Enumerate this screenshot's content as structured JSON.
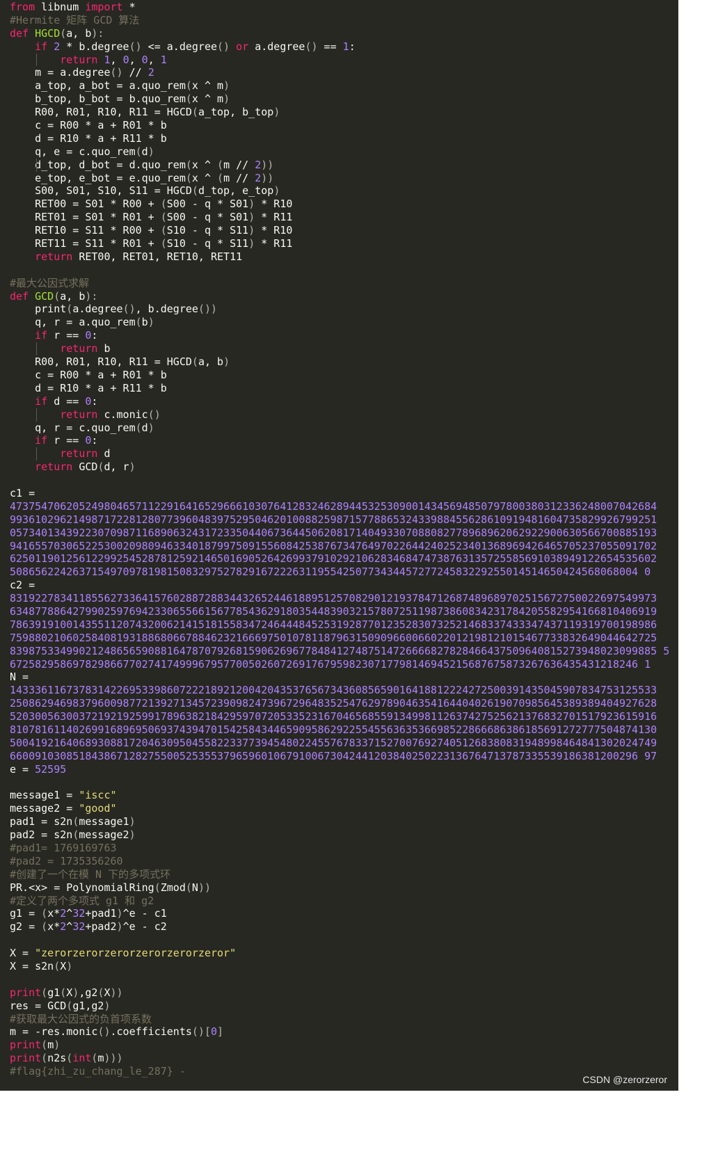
{
  "editor": {
    "theme": {
      "background": "#272822",
      "plain": "#f8f8f2",
      "keyword": "#f92672",
      "function": "#a6e22e",
      "number": "#ae81ff",
      "string": "#e6db74",
      "comment": "#75715e"
    },
    "lines": [
      [
        [
          "from",
          "kw"
        ],
        [
          " libnum ",
          "pl"
        ],
        [
          "import",
          "kw"
        ],
        [
          " *",
          "pl"
        ]
      ],
      [
        [
          "#Hermite 矩阵 GCD 算法",
          "cm"
        ]
      ],
      [
        [
          "def",
          "kw"
        ],
        [
          " ",
          "pl"
        ],
        [
          "HGCD",
          "fn"
        ],
        [
          "(",
          "pu"
        ],
        [
          "a, b",
          "pl"
        ],
        [
          "):",
          "pu"
        ]
      ],
      [
        [
          "    ",
          "pl"
        ],
        [
          "if",
          "kw"
        ],
        [
          " ",
          "pl"
        ],
        [
          "2",
          "num"
        ],
        [
          " * b.degree",
          "pl"
        ],
        [
          "()",
          "pu"
        ],
        [
          " <= a.degree",
          "pl"
        ],
        [
          "()",
          "pu"
        ],
        [
          " ",
          "pl"
        ],
        [
          "or",
          "kw"
        ],
        [
          " a.degree",
          "pl"
        ],
        [
          "()",
          "pu"
        ],
        [
          " == ",
          "pl"
        ],
        [
          "1",
          "num"
        ],
        [
          ":",
          "pl"
        ]
      ],
      [
        [
          "        ",
          "pl"
        ],
        [
          "return",
          "kw"
        ],
        [
          " ",
          "pl"
        ],
        [
          "1",
          "num"
        ],
        [
          ", ",
          "pl"
        ],
        [
          "0",
          "num"
        ],
        [
          ", ",
          "pl"
        ],
        [
          "0",
          "num"
        ],
        [
          ", ",
          "pl"
        ],
        [
          "1",
          "num"
        ]
      ],
      [
        [
          "    m = a.degree",
          "pl"
        ],
        [
          "()",
          "pu"
        ],
        [
          " // ",
          "pl"
        ],
        [
          "2",
          "num"
        ]
      ],
      [
        [
          "    a_top, a_bot = a.quo_rem",
          "pl"
        ],
        [
          "(",
          "pu"
        ],
        [
          "x ^ m",
          "pl"
        ],
        [
          ")",
          "pu"
        ]
      ],
      [
        [
          "    b_top, b_bot = b.quo_rem",
          "pl"
        ],
        [
          "(",
          "pu"
        ],
        [
          "x ^ m",
          "pl"
        ],
        [
          ")",
          "pu"
        ]
      ],
      [
        [
          "    R00, R01, R10, R11 = HGCD",
          "pl"
        ],
        [
          "(",
          "pu"
        ],
        [
          "a_top, b_top",
          "pl"
        ],
        [
          ")",
          "pu"
        ]
      ],
      [
        [
          "    c = R00 * a + R01 * b",
          "pl"
        ]
      ],
      [
        [
          "    d = R10 * a + R11 * b",
          "pl"
        ]
      ],
      [
        [
          "    q, e = c.quo_rem",
          "pl"
        ],
        [
          "(",
          "pu"
        ],
        [
          "d",
          "pl"
        ],
        [
          ")",
          "pu"
        ]
      ],
      [
        [
          "    d_top, d_bot = d.quo_rem",
          "pl"
        ],
        [
          "(",
          "pu"
        ],
        [
          "x ^ ",
          "pl"
        ],
        [
          "(",
          "pu"
        ],
        [
          "m // ",
          "pl"
        ],
        [
          "2",
          "num"
        ],
        [
          "))",
          "pu"
        ]
      ],
      [
        [
          "    e_top, e_bot = e.quo_rem",
          "pl"
        ],
        [
          "(",
          "pu"
        ],
        [
          "x ^ ",
          "pl"
        ],
        [
          "(",
          "pu"
        ],
        [
          "m // ",
          "pl"
        ],
        [
          "2",
          "num"
        ],
        [
          "))",
          "pu"
        ]
      ],
      [
        [
          "    S00, S01, S10, S11 = HGCD",
          "pl"
        ],
        [
          "(",
          "pu"
        ],
        [
          "d_top, e_top",
          "pl"
        ],
        [
          ")",
          "pu"
        ]
      ],
      [
        [
          "    RET00 = S01 * R00 + ",
          "pl"
        ],
        [
          "(",
          "pu"
        ],
        [
          "S00 - q * S01",
          "pl"
        ],
        [
          ")",
          "pu"
        ],
        [
          " * R10",
          "pl"
        ]
      ],
      [
        [
          "    RET01 = S01 * R01 + ",
          "pl"
        ],
        [
          "(",
          "pu"
        ],
        [
          "S00 - q * S01",
          "pl"
        ],
        [
          ")",
          "pu"
        ],
        [
          " * R11",
          "pl"
        ]
      ],
      [
        [
          "    RET10 = S11 * R00 + ",
          "pl"
        ],
        [
          "(",
          "pu"
        ],
        [
          "S10 - q * S11",
          "pl"
        ],
        [
          ")",
          "pu"
        ],
        [
          " * R10",
          "pl"
        ]
      ],
      [
        [
          "    RET11 = S11 * R01 + ",
          "pl"
        ],
        [
          "(",
          "pu"
        ],
        [
          "S10 - q * S11",
          "pl"
        ],
        [
          ")",
          "pu"
        ],
        [
          " * R11",
          "pl"
        ]
      ],
      [
        [
          "    ",
          "pl"
        ],
        [
          "return",
          "kw"
        ],
        [
          " RET00, RET01, RET10, RET11",
          "pl"
        ]
      ],
      [],
      [
        [
          "#最大公因式求解",
          "cm"
        ]
      ],
      [
        [
          "def",
          "kw"
        ],
        [
          " ",
          "pl"
        ],
        [
          "GCD",
          "fn"
        ],
        [
          "(",
          "pu"
        ],
        [
          "a, b",
          "pl"
        ],
        [
          "):",
          "pu"
        ]
      ],
      [
        [
          "    print",
          "pl"
        ],
        [
          "(",
          "pu"
        ],
        [
          "a.degree",
          "pl"
        ],
        [
          "()",
          "pu"
        ],
        [
          ", b.degree",
          "pl"
        ],
        [
          "())",
          "pu"
        ]
      ],
      [
        [
          "    q, r = a.quo_rem",
          "pl"
        ],
        [
          "(",
          "pu"
        ],
        [
          "b",
          "pl"
        ],
        [
          ")",
          "pu"
        ]
      ],
      [
        [
          "    ",
          "pl"
        ],
        [
          "if",
          "kw"
        ],
        [
          " r == ",
          "pl"
        ],
        [
          "0",
          "num"
        ],
        [
          ":",
          "pl"
        ]
      ],
      [
        [
          "        ",
          "pl"
        ],
        [
          "return",
          "kw"
        ],
        [
          " b",
          "pl"
        ]
      ],
      [
        [
          "    R00, R01, R10, R11 = HGCD",
          "pl"
        ],
        [
          "(",
          "pu"
        ],
        [
          "a, b",
          "pl"
        ],
        [
          ")",
          "pu"
        ]
      ],
      [
        [
          "    c = R00 * a + R01 * b",
          "pl"
        ]
      ],
      [
        [
          "    d = R10 * a + R11 * b",
          "pl"
        ]
      ],
      [
        [
          "    ",
          "pl"
        ],
        [
          "if",
          "kw"
        ],
        [
          " d == ",
          "pl"
        ],
        [
          "0",
          "num"
        ],
        [
          ":",
          "pl"
        ]
      ],
      [
        [
          "        ",
          "pl"
        ],
        [
          "return",
          "kw"
        ],
        [
          " c.monic",
          "pl"
        ],
        [
          "()",
          "pu"
        ]
      ],
      [
        [
          "    q, r = c.quo_rem",
          "pl"
        ],
        [
          "(",
          "pu"
        ],
        [
          "d",
          "pl"
        ],
        [
          ")",
          "pu"
        ]
      ],
      [
        [
          "    ",
          "pl"
        ],
        [
          "if",
          "kw"
        ],
        [
          " r == ",
          "pl"
        ],
        [
          "0",
          "num"
        ],
        [
          ":",
          "pl"
        ]
      ],
      [
        [
          "        ",
          "pl"
        ],
        [
          "return",
          "kw"
        ],
        [
          " d",
          "pl"
        ]
      ],
      [
        [
          "    ",
          "pl"
        ],
        [
          "return",
          "kw"
        ],
        [
          " GCD",
          "pl"
        ],
        [
          "(",
          "pu"
        ],
        [
          "d, r",
          "pl"
        ],
        [
          ")",
          "pu"
        ]
      ],
      [],
      [
        [
          "c1 =",
          "pl"
        ]
      ],
      [
        [
          "4737547062052498046571122916416529666103076412832462894453253090014345694850797800380312336248007042684",
          "big"
        ]
      ],
      [
        [
          "9936102962149871722812807739604839752950462010088259871577886532433988455628610919481604735829926799251",
          "big"
        ]
      ],
      [
        [
          "0573401343922307098711689063243172335044067364450620817140493307088082778968962062922900630566700885193",
          "big"
        ]
      ],
      [
        [
          "9416557030652253002098094633401879975091556084253876734764970226442402523401368969426465705237055091702",
          "big"
        ]
      ],
      [
        [
          "6250119012561229925452878125921465016905264269937910292106283468474738763135725585691038949122654535602",
          "big"
        ]
      ],
      [
        [
          "5086562242637154970978198150832975278291672226311955425077343445727724583229255014514650424568068004 0",
          "big"
        ]
      ],
      [
        [
          "c2 =",
          "pl"
        ]
      ],
      [
        [
          "8319227834118556273364157602887288344326524461889512570829012193784712687489689702515672750022697549973",
          "big"
        ]
      ],
      [
        [
          "6348778864279902597694233065566156778543629180354483903215780725119873860834231784205582954166810406919",
          "big"
        ]
      ],
      [
        [
          "7863919100143551120743200621415181558347246444845253192877012352830732521468337433347437119319700198986",
          "big"
        ]
      ],
      [
        [
          "7598802106025840819318868066788462321666975010781187963150909660066022012198121015467733832649044642725",
          "big"
        ]
      ],
      [
        [
          "8398753349902124865659088164787079268159062696778484127487514726666827828466437509640815273948023099885 5",
          "big"
        ]
      ],
      [
        [
          "6725829586978298667702741749996795770050260726917679598230717798146945215687675873267636435431218246 1",
          "big"
        ]
      ],
      [
        [
          "N =",
          "pl"
        ]
      ],
      [
        [
          "1433361167378314226953398607222189212004204353765673436085659016418812224272500391435045907834753125533",
          "big"
        ]
      ],
      [
        [
          "2508629469837960098772139271345723909824739672964835254762978904635416440402619070985645389389404927628",
          "big"
        ]
      ],
      [
        [
          "5203005630037219219259917896382184295970720533523167046568559134998112637427525621376832701517923615916",
          "big"
        ]
      ],
      [
        [
          "8107816114026991689695069374394701542584344659095862922554556363536698522866686386185691272777504874130",
          "big"
        ]
      ],
      [
        [
          "5004192164068930881720463095045582233773945480224557678337152700769274051268380831948998464841302024749",
          "big"
        ]
      ],
      [
        [
          "6600910308518438671282755005253553796596010679100673042441203840250223136764713787335539186381200296 97",
          "big"
        ]
      ],
      [
        [
          "e = ",
          "pl"
        ],
        [
          "52595",
          "num"
        ]
      ],
      [],
      [
        [
          "message1 = ",
          "pl"
        ],
        [
          "\"iscc\"",
          "str"
        ]
      ],
      [
        [
          "message2 = ",
          "pl"
        ],
        [
          "\"good\"",
          "str"
        ]
      ],
      [
        [
          "pad1 = s2n",
          "pl"
        ],
        [
          "(",
          "pu"
        ],
        [
          "message1",
          "pl"
        ],
        [
          ")",
          "pu"
        ]
      ],
      [
        [
          "pad2 = s2n",
          "pl"
        ],
        [
          "(",
          "pu"
        ],
        [
          "message2",
          "pl"
        ],
        [
          ")",
          "pu"
        ]
      ],
      [
        [
          "#pad1= 1769169763",
          "cm"
        ]
      ],
      [
        [
          "#pad2 = 1735356260",
          "cm"
        ]
      ],
      [
        [
          "#创建了一个在模 N 下的多项式环",
          "cm"
        ]
      ],
      [
        [
          "PR.<x> = PolynomialRing",
          "pl"
        ],
        [
          "(",
          "pu"
        ],
        [
          "Zmod",
          "pl"
        ],
        [
          "(",
          "pu"
        ],
        [
          "N",
          "pl"
        ],
        [
          "))",
          "pu"
        ]
      ],
      [
        [
          "#定义了两个多项式 g1 和 g2",
          "cm"
        ]
      ],
      [
        [
          "g1 = ",
          "pl"
        ],
        [
          "(",
          "pu"
        ],
        [
          "x*",
          "pl"
        ],
        [
          "2",
          "num"
        ],
        [
          "^",
          "pl"
        ],
        [
          "32",
          "num"
        ],
        [
          "+pad1",
          "pl"
        ],
        [
          ")",
          "pu"
        ],
        [
          "^e - c1",
          "pl"
        ]
      ],
      [
        [
          "g2 = ",
          "pl"
        ],
        [
          "(",
          "pu"
        ],
        [
          "x*",
          "pl"
        ],
        [
          "2",
          "num"
        ],
        [
          "^",
          "pl"
        ],
        [
          "32",
          "num"
        ],
        [
          "+pad2",
          "pl"
        ],
        [
          ")",
          "pu"
        ],
        [
          "^e - c2",
          "pl"
        ]
      ],
      [],
      [
        [
          "X = ",
          "pl"
        ],
        [
          "\"zerorzerorzerorzerorzerorzeror\"",
          "str"
        ]
      ],
      [
        [
          "X = s2n",
          "pl"
        ],
        [
          "(",
          "pu"
        ],
        [
          "X",
          "pl"
        ],
        [
          ")",
          "pu"
        ]
      ],
      [],
      [
        [
          "print",
          "kw"
        ],
        [
          "(",
          "pu"
        ],
        [
          "g1",
          "pl"
        ],
        [
          "(",
          "pu"
        ],
        [
          "X",
          "pl"
        ],
        [
          ")",
          "pu"
        ],
        [
          ",g2",
          "pl"
        ],
        [
          "(",
          "pu"
        ],
        [
          "X",
          "pl"
        ],
        [
          "))",
          "pu"
        ]
      ],
      [
        [
          "res = GCD",
          "pl"
        ],
        [
          "(",
          "pu"
        ],
        [
          "g1,g2",
          "pl"
        ],
        [
          ")",
          "pu"
        ]
      ],
      [
        [
          "#获取最大公因式的负首项系数",
          "cm"
        ]
      ],
      [
        [
          "m = -res.monic",
          "pl"
        ],
        [
          "()",
          "pu"
        ],
        [
          ".coefficients",
          "pl"
        ],
        [
          "()[",
          "pu"
        ],
        [
          "0",
          "num"
        ],
        [
          "]",
          "pu"
        ]
      ],
      [
        [
          "print",
          "kw"
        ],
        [
          "(",
          "pu"
        ],
        [
          "m",
          "pl"
        ],
        [
          ")",
          "pu"
        ]
      ],
      [
        [
          "print",
          "kw"
        ],
        [
          "(",
          "pu"
        ],
        [
          "n2s",
          "pl"
        ],
        [
          "(",
          "pu"
        ],
        [
          "int",
          "kw"
        ],
        [
          "(",
          "pu"
        ],
        [
          "m",
          "pl"
        ],
        [
          ")))",
          "pu"
        ]
      ],
      [
        [
          "#flag{zhi_zu_chang_le_287} -",
          "cm"
        ]
      ]
    ],
    "indent_guides": [
      4,
      12,
      26,
      31,
      34
    ]
  },
  "watermark": "CSDN @zerorzeror"
}
